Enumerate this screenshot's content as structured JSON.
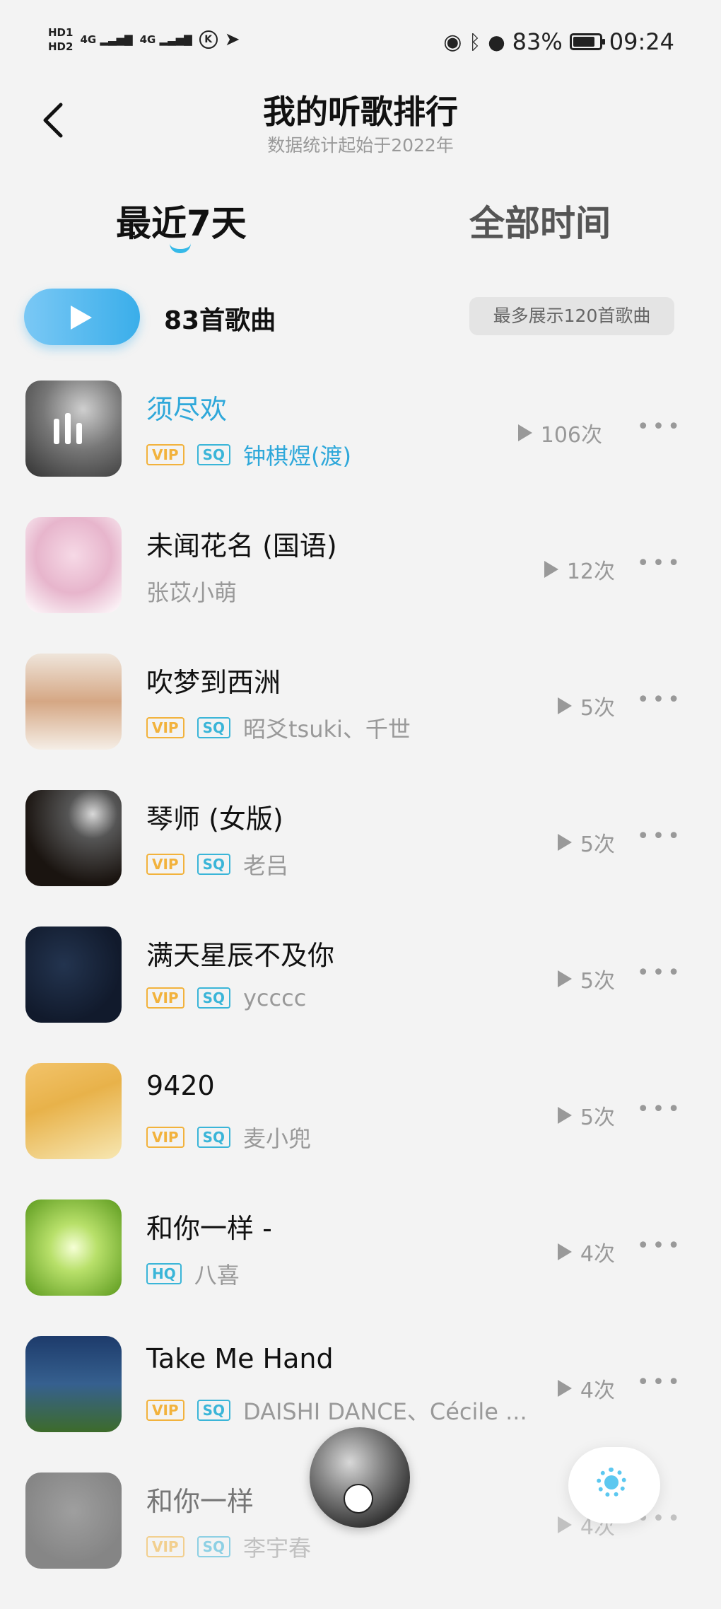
{
  "status_bar": {
    "hd1": "HD1",
    "hd2": "HD2",
    "sig1": "4G",
    "sig2": "4G",
    "k_icon": "K",
    "battery_percent": "83%",
    "battery_level": 83,
    "time": "09:24"
  },
  "header": {
    "title": "我的听歌排行",
    "subtitle": "数据统计起始于2022年"
  },
  "tabs": {
    "active": "最近7天",
    "inactive": "全部时间"
  },
  "summary": {
    "count": "83首歌曲",
    "limit": "最多展示120首歌曲"
  },
  "songs": [
    {
      "title": "须尽欢",
      "tags": [
        "VIP",
        "SQ"
      ],
      "artist": "钟棋煜(渡)",
      "plays": "106次",
      "playing": true
    },
    {
      "title": "未闻花名 (国语)",
      "tags": [],
      "artist": "张苡小萌",
      "plays": "12次"
    },
    {
      "title": "吹梦到西洲",
      "tags": [
        "VIP",
        "SQ"
      ],
      "artist": "昭爻tsuki、千世",
      "plays": "5次"
    },
    {
      "title": "琴师 (女版)",
      "tags": [
        "VIP",
        "SQ"
      ],
      "artist": "老吕",
      "plays": "5次"
    },
    {
      "title": "满天星辰不及你",
      "tags": [
        "VIP",
        "SQ"
      ],
      "artist": "ycccc",
      "plays": "5次"
    },
    {
      "title": "9420",
      "tags": [
        "VIP",
        "SQ"
      ],
      "artist": "麦小兜",
      "plays": "5次"
    },
    {
      "title": "和你一样 -",
      "tags": [
        "HQ"
      ],
      "artist": "八喜",
      "plays": "4次"
    },
    {
      "title": "Take Me Hand",
      "tags": [
        "VIP",
        "SQ"
      ],
      "artist": "DAISHI DANCE、Cécile ...",
      "plays": "4次"
    },
    {
      "title": "和你一样",
      "tags": [
        "VIP",
        "SQ"
      ],
      "artist": "李宇春",
      "plays": "4次"
    }
  ],
  "more_label": "•••",
  "colors": {
    "accent": "#2fa8da",
    "vip": "#f2b23c",
    "sq": "#3ab5d8"
  }
}
